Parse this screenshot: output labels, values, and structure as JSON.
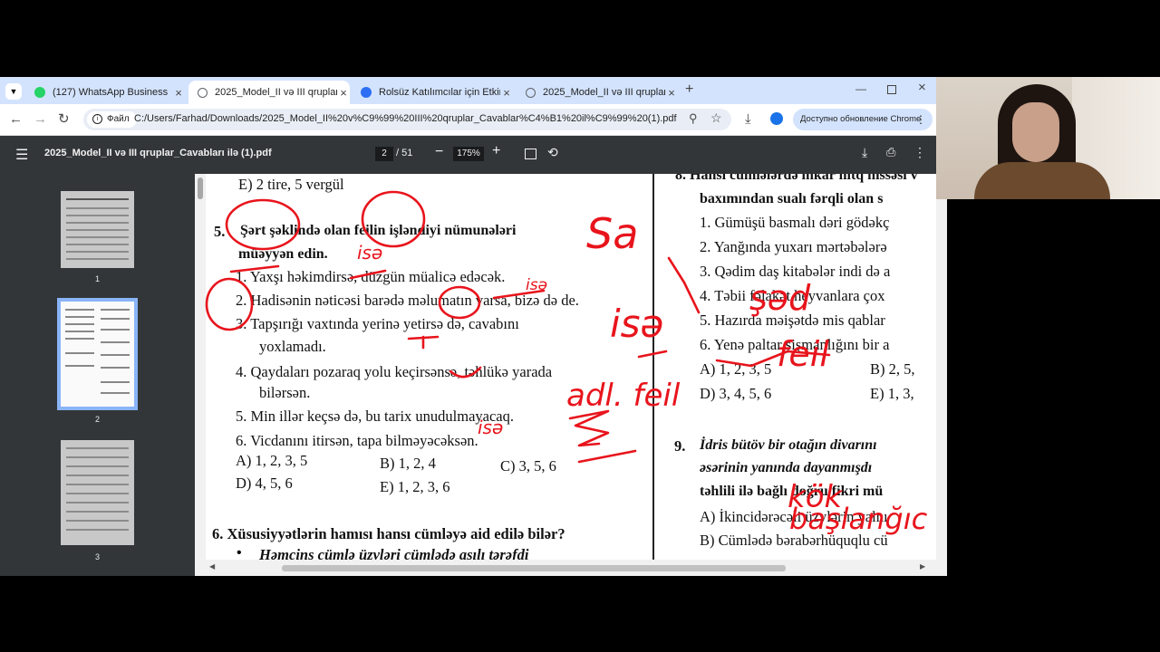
{
  "tabs": [
    {
      "title": "(127) WhatsApp Business",
      "icon": "whatsapp-icon",
      "active": false
    },
    {
      "title": "2025_Model_II və III qruplar_Ca",
      "icon": "globe-icon",
      "active": true
    },
    {
      "title": "Rolsüz Katılımcılar için Etkinlik :",
      "icon": "zoom-icon",
      "active": false
    },
    {
      "title": "2025_Model_II və III qruplar_Ca",
      "icon": "globe-icon",
      "active": false
    }
  ],
  "toolbar": {
    "file_chip": "Файл",
    "url": "C:/Users/Farhad/Downloads/2025_Model_II%20v%C9%99%20III%20qruplar_Cavablar%C4%B1%20il%C9%99%20(1).pdf",
    "update_label": "Доступно обновление Chrome"
  },
  "pdf": {
    "filename": "2025_Model_II və III qruplar_Cavabları ilə (1).pdf",
    "page_current": "2",
    "page_total": "/ 51",
    "zoom": "175%"
  },
  "thumbnails": [
    {
      "label": "1"
    },
    {
      "label": "2"
    },
    {
      "label": "3"
    }
  ],
  "left_column": {
    "prev_option": "E) 2 tire, 5 vergül",
    "q5_number": "5.",
    "q5_line1": "Şərt şəklində olan feilin işləndiyi nümunələri",
    "q5_line2": "müəyyən edin.",
    "items": [
      "1. Yaxşı həkimdirsə, düzgün müalicə edəcək.",
      "2. Hadisənin nəticəsi barədə məlumatın varsa, bizə də de.",
      "3. Tapşırığı vaxtında yerinə yetirsə də, cavabını",
      "yoxlamadı.",
      "4. Qaydaları pozaraq yolu keçirsənsə, təhlükə yarada",
      "bilərsən.",
      "5. Min illər keçsə də, bu tarix unudulmayacaq.",
      "6. Vicdanını itirsən, tapa bilməyəcəksən."
    ],
    "options": {
      "a": "A) 1, 2, 3, 5",
      "b": "B) 1, 2, 4",
      "c": "C) 3, 5, 6",
      "d": "D) 4, 5, 6",
      "e": "E) 1, 2, 3, 6"
    },
    "q6_title": "6. Xüsusiyyətlərin hamısı hansı cümləyə aid edilə bilər?",
    "q6_bullet": "Həmcins cümlə üzvləri cümlədə asılı tərəfdi"
  },
  "right_column": {
    "q8_line1": "8. Hansı cümlələrdə inkar nitq hissəsi v",
    "q8_line2": "baxımından sualı fərqli olan s",
    "items": [
      "1. Gümüşü basmalı dəri gödəkç",
      "2. Yanğında yuxarı mərtəbələrə",
      "3. Qədim daş kitabələr indi də a",
      "4. Təbii fəlakət heyvanlara çox",
      "5. Hazırda məişətdə mis qablar",
      "6. Yenə paltar şişmanlığını bir a"
    ],
    "options": {
      "a": "A) 1, 2, 3, 5",
      "b": "B) 2, 5,",
      "d": "D) 3, 4, 5, 6",
      "e": "E) 1, 3,"
    },
    "q9_number": "9.",
    "q9_line1": "İdris bütöv bir otağın divarını",
    "q9_line2": "əsərinin yanında dayanmışdı",
    "q9_line3": "təhlili ilə bağlı doğru fikri mü",
    "q9_a": "A) İkincidərəcəli üzvlərin yalnı",
    "q9_b": "B) Cümlədə bərabərhüquqlu cü"
  },
  "annotations": {
    "color": "#e8141c",
    "texts": [
      "Sa",
      "isə",
      "isə",
      "isə",
      "isə",
      "şəd",
      "feil",
      "adl. feil",
      "kök",
      "başlanğıc"
    ]
  }
}
